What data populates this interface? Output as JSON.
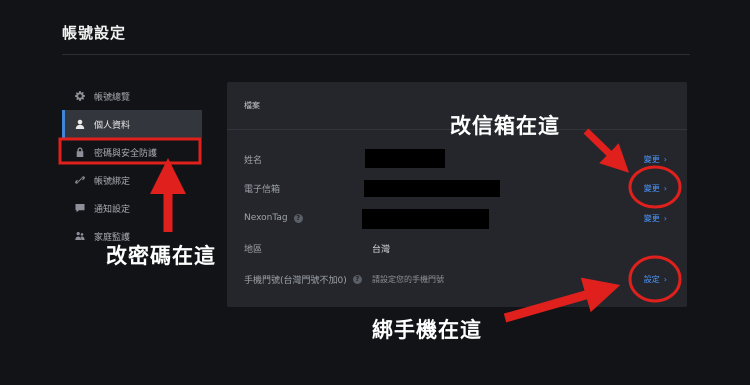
{
  "page": {
    "title": "帳號設定"
  },
  "sidebar": {
    "items": [
      {
        "label": "帳號總覽",
        "icon": "gear-icon"
      },
      {
        "label": "個人資料",
        "icon": "user-icon",
        "active": true
      },
      {
        "label": "密碼與安全防護",
        "icon": "lock-icon"
      },
      {
        "label": "帳號綁定",
        "icon": "link-icon"
      },
      {
        "label": "通知設定",
        "icon": "message-icon"
      },
      {
        "label": "家庭監護",
        "icon": "family-icon"
      }
    ]
  },
  "profile": {
    "header": "檔案",
    "rows": [
      {
        "label": "姓名",
        "action": "變更"
      },
      {
        "label": "電子信箱",
        "action": "變更"
      },
      {
        "label": "NexonTag",
        "help": "?",
        "action": "變更"
      },
      {
        "label": "地區",
        "value": "台灣"
      },
      {
        "label": "手機門號(台灣門號不加0)",
        "help": "?",
        "hint": "請設定您的手機門號",
        "action": "設定"
      }
    ]
  },
  "annotations": {
    "email": "改信箱在這",
    "password": "改密碼在這",
    "phone": "綁手機在這"
  },
  "colors": {
    "background": "#121316",
    "panel": "#24262b",
    "accent_link": "#4d98ff",
    "active_bar": "#3f86d8",
    "annotation_red": "#e0201c"
  }
}
